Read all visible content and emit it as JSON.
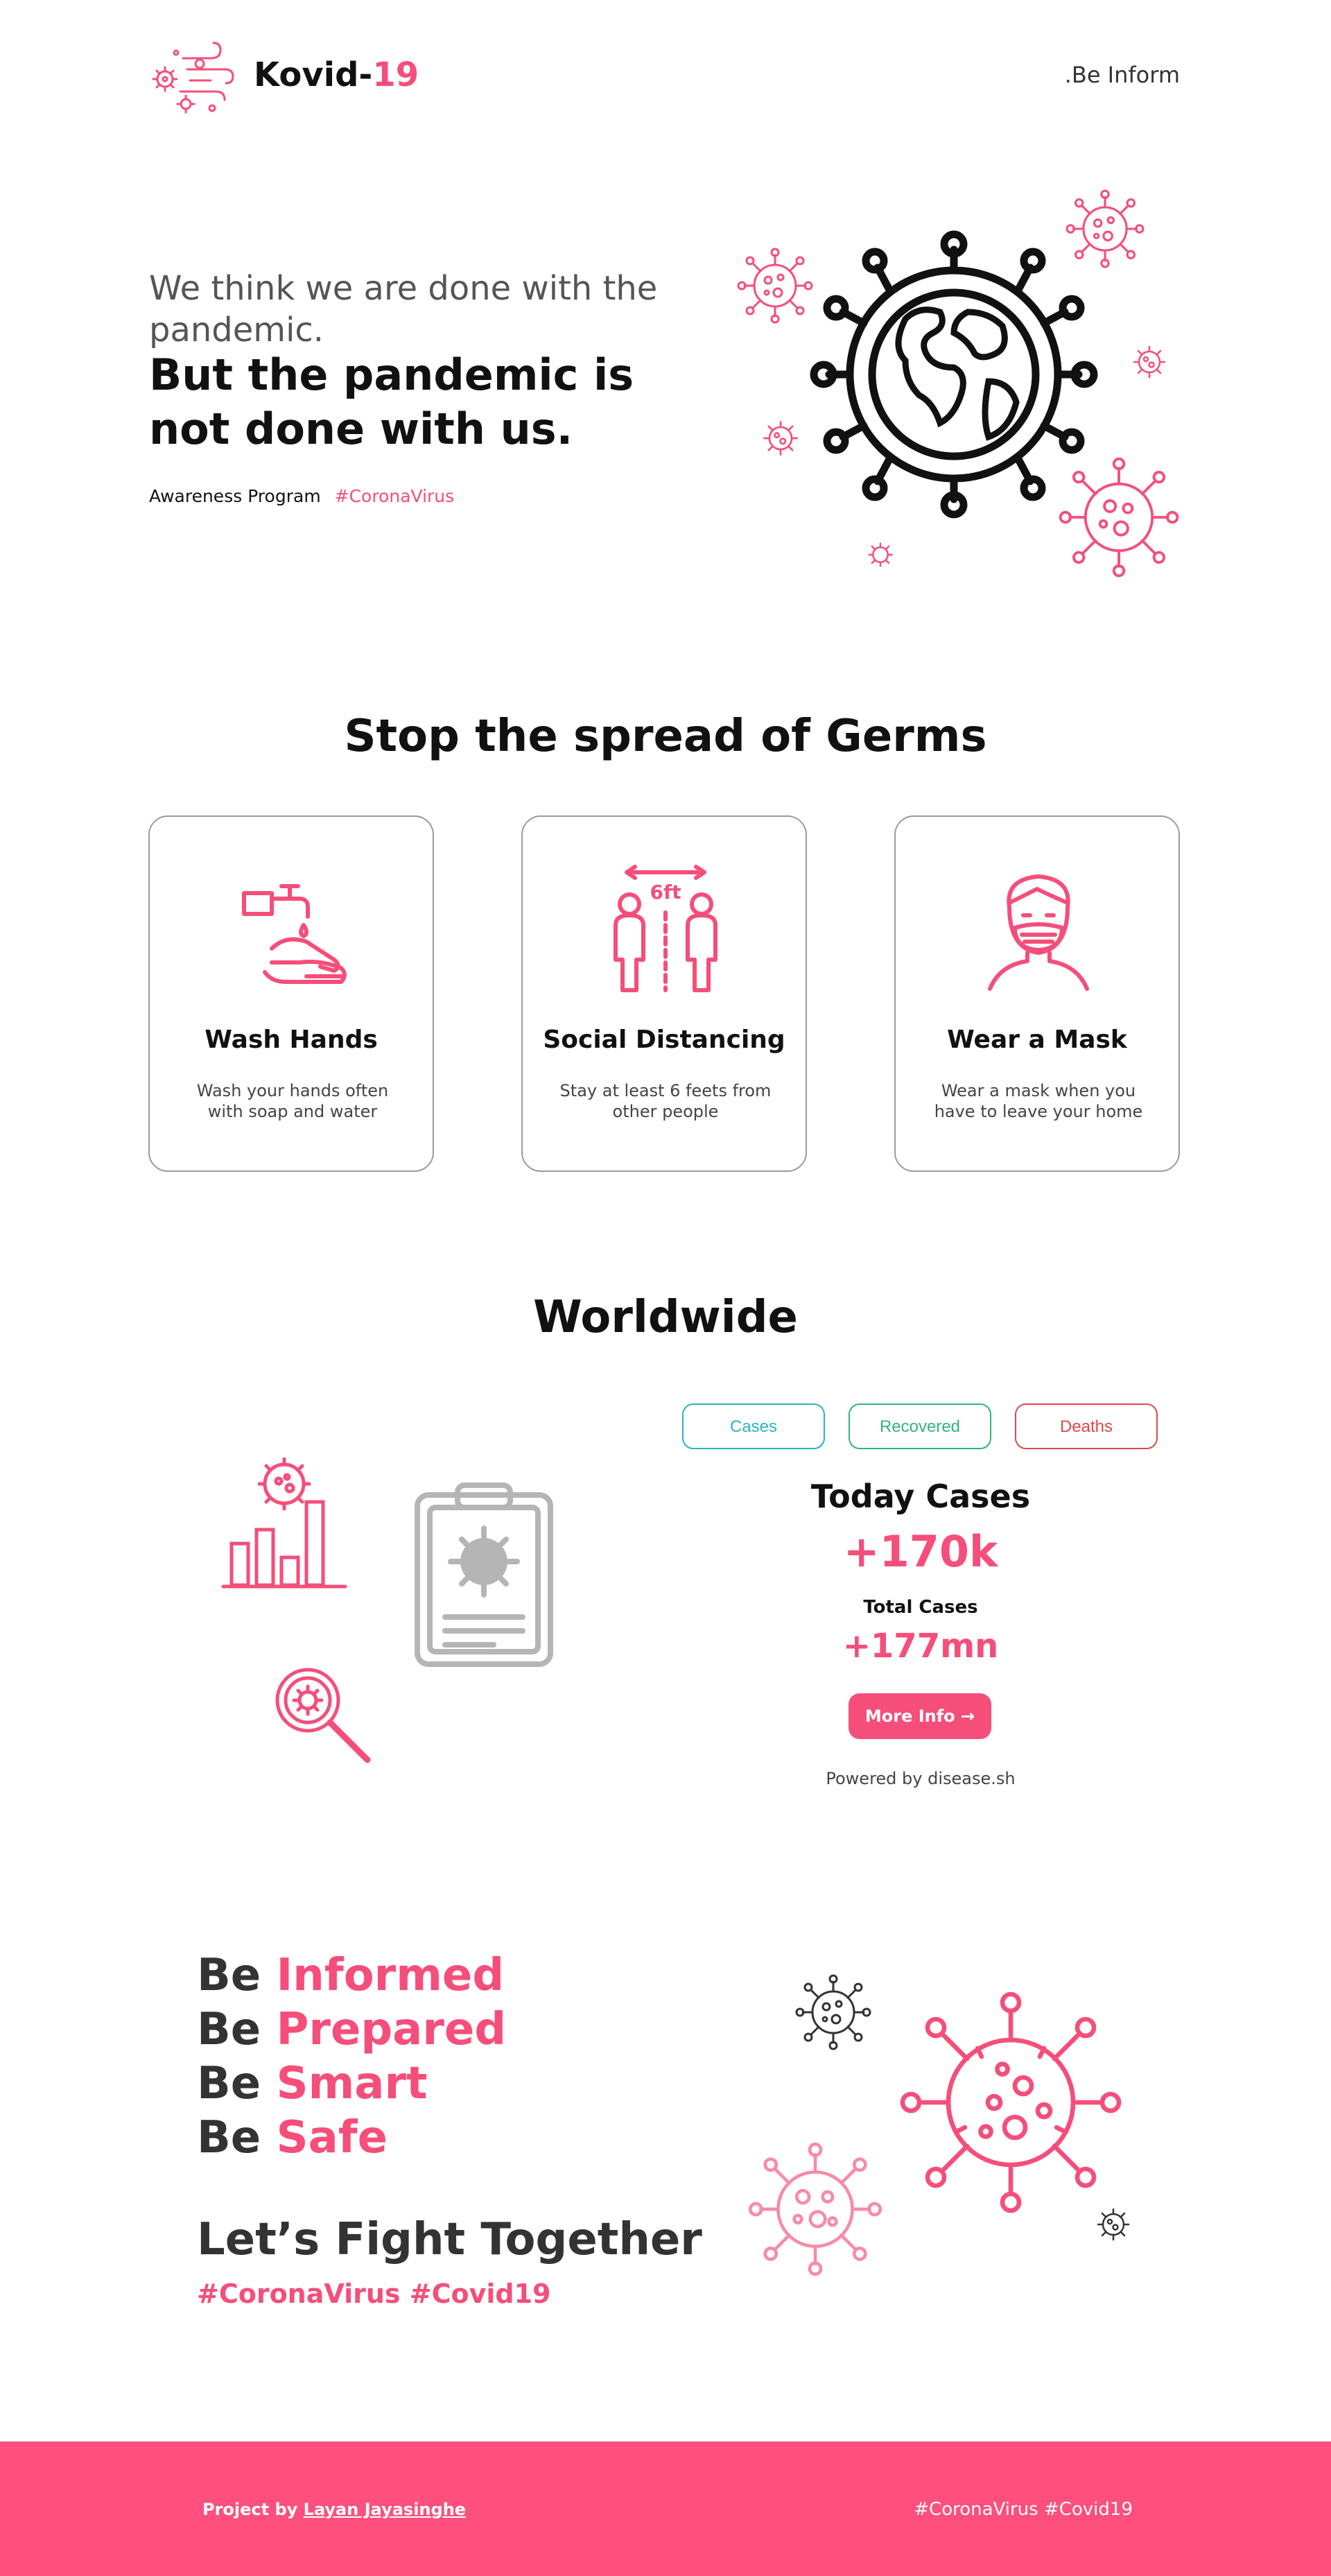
{
  "header": {
    "brand_main": "Kovid-",
    "brand_accent": "19",
    "nav_link": ".Be Inform",
    "logo_icon": "virus-wind-icon"
  },
  "hero": {
    "line1": "We think we are done with the pandemic.",
    "line2": "But the pandemic is not done with us.",
    "tag_label": "Awareness Program",
    "tag_hashtag": "#CoronaVirus",
    "illustration_icon": "globe-virus-icon"
  },
  "germs": {
    "title": "Stop the spread of Germs",
    "cards": [
      {
        "title": "Wash Hands",
        "description": "Wash your hands often with soap and water",
        "icon": "wash-hands-icon"
      },
      {
        "title": "Social Distancing",
        "description": "Stay at least 6 feets from other people",
        "icon": "social-distancing-icon",
        "icon_text": "6ft"
      },
      {
        "title": "Wear a Mask",
        "description": "Wear a mask when you have to leave your home",
        "icon": "face-mask-icon"
      }
    ]
  },
  "worldwide": {
    "title": "Worldwide",
    "tabs": [
      {
        "label": "Cases",
        "color": "#2bb3c0"
      },
      {
        "label": "Recovered",
        "color": "#33b37a"
      },
      {
        "label": "Deaths",
        "color": "#e04848"
      }
    ],
    "today_label": "Today Cases",
    "today_value": "+170k",
    "total_label": "Total Cases",
    "total_value": "+177mn",
    "more_button": "More Info →",
    "powered_by": "Powered by disease.sh"
  },
  "be_section": {
    "lines": [
      {
        "prefix": "Be",
        "accent": "Informed"
      },
      {
        "prefix": "Be",
        "accent": "Prepared"
      },
      {
        "prefix": "Be",
        "accent": "Smart"
      },
      {
        "prefix": "Be",
        "accent": "Safe"
      }
    ],
    "fight_title": "Let’s Fight Together",
    "hashtags": "#CoronaVirus #Covid19"
  },
  "footer": {
    "credit_prefix": "Project by",
    "credit_name": "Layan Jayasinghe",
    "hashtags": "#CoronaVirus #Covid19"
  },
  "colors": {
    "accent": "#f54e7a",
    "footer_bg": "#ff4f7d",
    "text_dark": "#111111",
    "text_muted": "#555555"
  }
}
